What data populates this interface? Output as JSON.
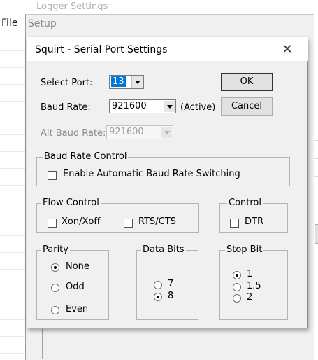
{
  "background_app": {
    "title": "Logger Settings",
    "menu_file": "File"
  },
  "setup_window": {
    "title": "Setup"
  },
  "dialog": {
    "title": "Squirt - Serial Port Settings",
    "close_glyph": "✕",
    "select_port": {
      "label": "Select Port:",
      "value": "13"
    },
    "baud_rate": {
      "label": "Baud Rate:",
      "value": "921600",
      "status": "(Active)"
    },
    "alt_baud_rate": {
      "label": "Alt Baud Rate:",
      "value": "921600"
    },
    "ok_label": "OK",
    "cancel_label": "Cancel",
    "baud_rate_control": {
      "title": "Baud Rate Control",
      "enable_auto": "Enable Automatic Baud Rate Switching"
    },
    "flow_control": {
      "title": "Flow Control",
      "xon_xoff": "Xon/Xoff",
      "rts_cts": "RTS/CTS"
    },
    "control": {
      "title": "Control",
      "dtr": "DTR"
    },
    "parity": {
      "title": "Parity",
      "options": [
        "None",
        "Odd",
        "Even"
      ],
      "selected": "None"
    },
    "data_bits": {
      "title": "Data Bits",
      "options": [
        "7",
        "8"
      ],
      "selected": "8"
    },
    "stop_bit": {
      "title": "Stop Bit",
      "options": [
        "1",
        "1.5",
        "2"
      ],
      "selected": "1"
    }
  },
  "colors": {
    "selection_highlight": "#0078d7",
    "dialog_bg": "#f0f0f0"
  }
}
